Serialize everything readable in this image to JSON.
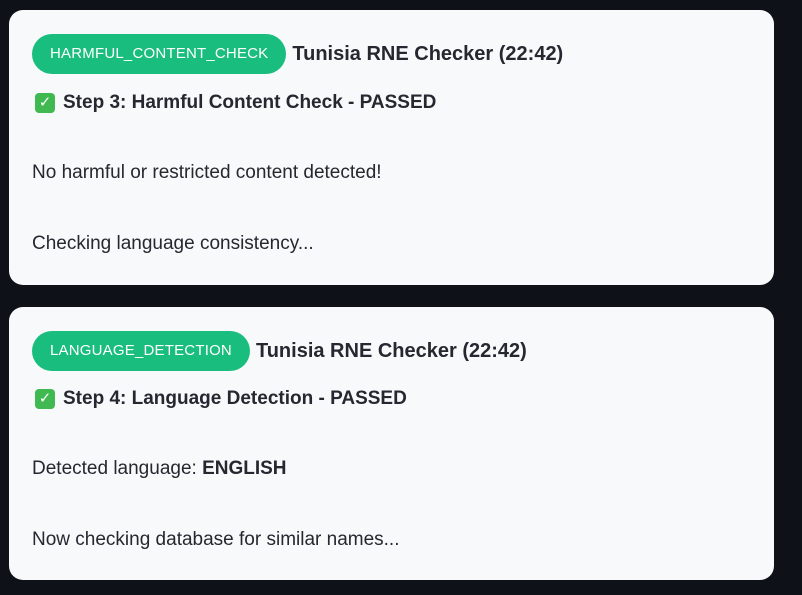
{
  "messages": [
    {
      "badge": "HARMFUL_CONTENT_CHECK",
      "checker": "Tunisia RNE Checker (22:42)",
      "step_icon": "check-mark-button-icon",
      "step_text": "Step 3: Harmful Content Check - PASSED",
      "line1": "No harmful or restricted content detected!",
      "line2": "Checking language consistency..."
    },
    {
      "badge": "LANGUAGE_DETECTION",
      "checker": "Tunisia RNE Checker (22:42)",
      "step_icon": "check-mark-button-icon",
      "step_text": "Step 4: Language Detection - PASSED",
      "line1_prefix": "Detected language: ",
      "line1_value": "ENGLISH",
      "line2": "Now checking database for similar names..."
    }
  ],
  "colors": {
    "background": "#0e1117",
    "card": "#f8f9fa",
    "badge": "#19bd7d",
    "check": "#3fb950",
    "text": "#262730"
  }
}
